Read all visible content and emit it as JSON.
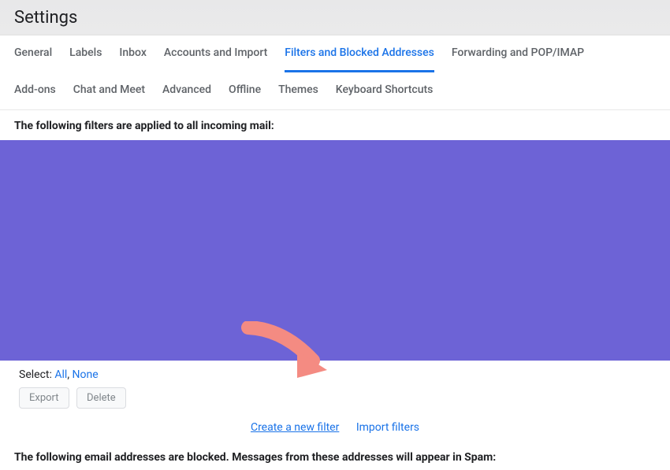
{
  "header": {
    "title": "Settings"
  },
  "tabs": [
    {
      "label": "General",
      "active": false
    },
    {
      "label": "Labels",
      "active": false
    },
    {
      "label": "Inbox",
      "active": false
    },
    {
      "label": "Accounts and Import",
      "active": false
    },
    {
      "label": "Filters and Blocked Addresses",
      "active": true
    },
    {
      "label": "Forwarding and POP/IMAP",
      "active": false
    },
    {
      "label": "Add-ons",
      "active": false
    },
    {
      "label": "Chat and Meet",
      "active": false
    },
    {
      "label": "Advanced",
      "active": false
    },
    {
      "label": "Offline",
      "active": false
    },
    {
      "label": "Themes",
      "active": false
    },
    {
      "label": "Keyboard Shortcuts",
      "active": false
    }
  ],
  "filters": {
    "heading": "The following filters are applied to all incoming mail:",
    "select_label": "Select:",
    "select_all": "All",
    "select_none": "None",
    "export_button": "Export",
    "delete_button": "Delete",
    "create_link": "Create a new filter",
    "import_link": "Import filters"
  },
  "blocked": {
    "heading": "The following email addresses are blocked. Messages from these addresses will appear in Spam:"
  },
  "annotation": {
    "arrow_color": "#f48b82"
  }
}
